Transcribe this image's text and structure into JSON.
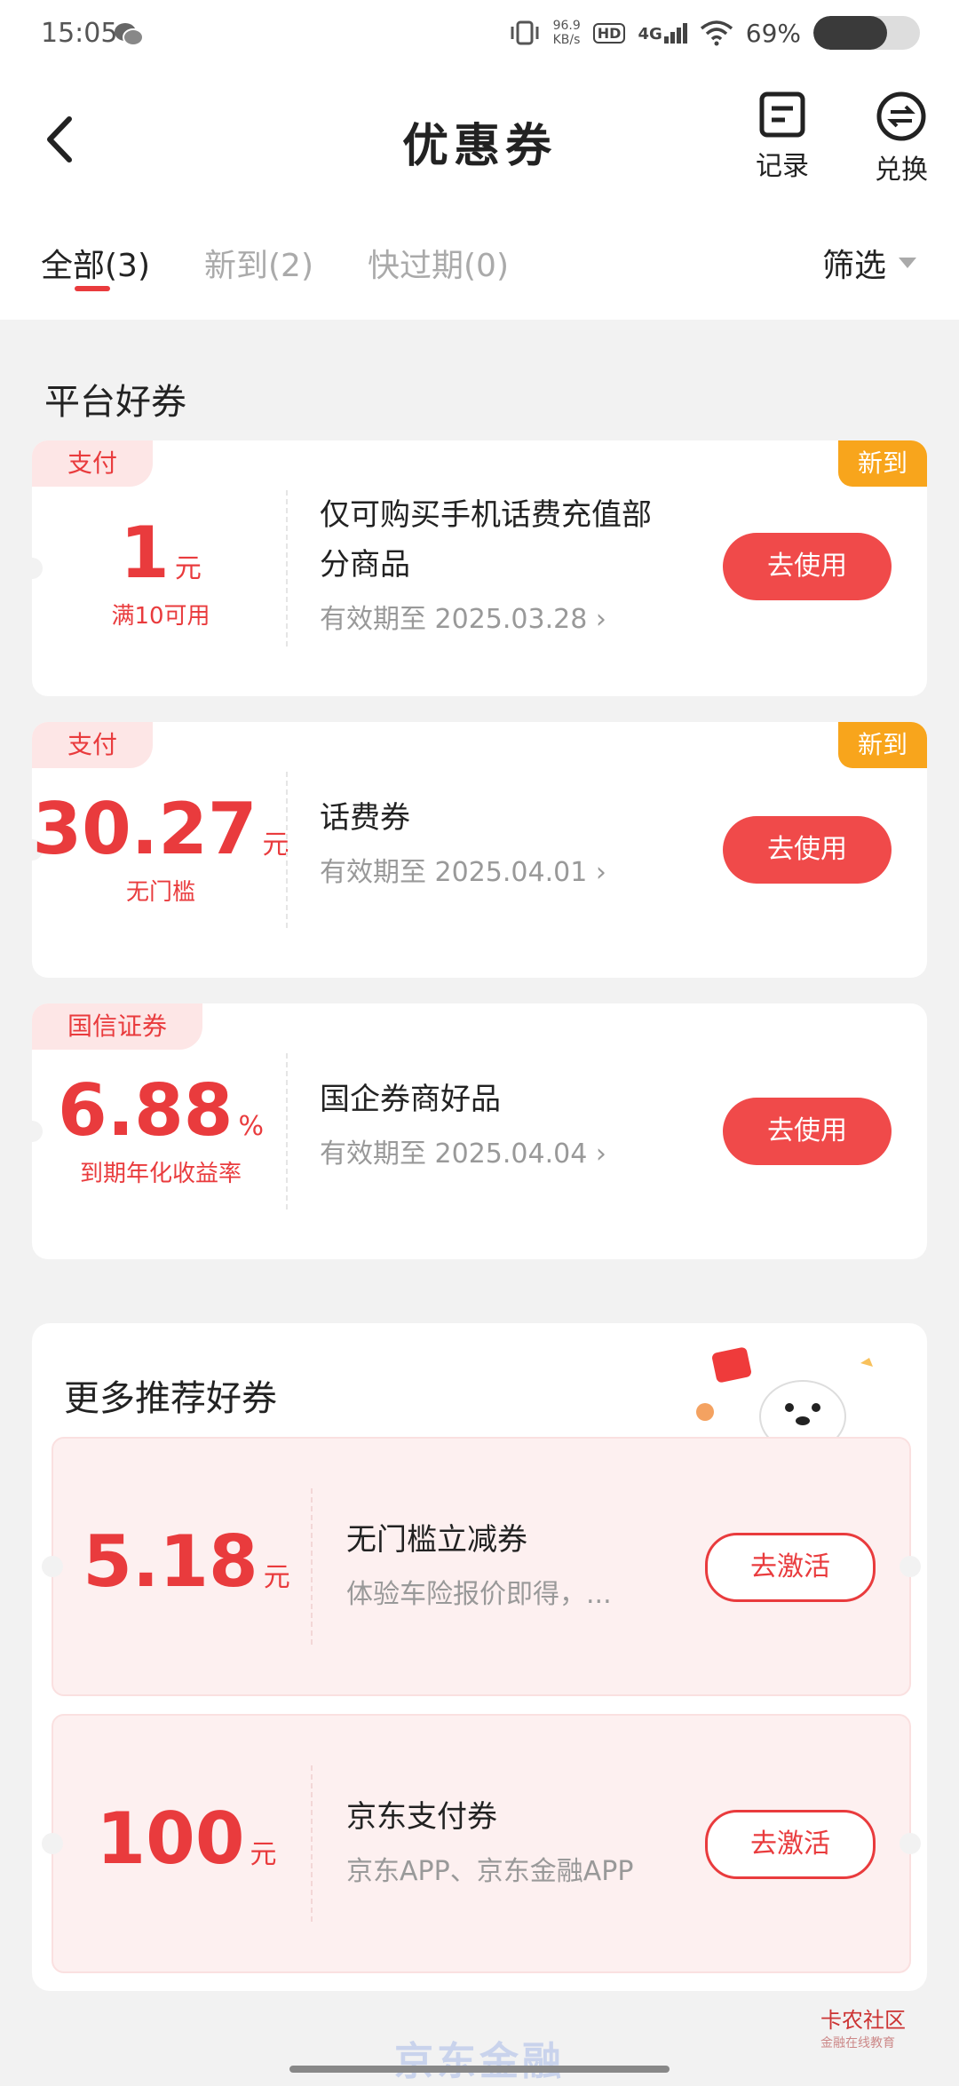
{
  "status_bar": {
    "time": "15:05",
    "net_speed_value": "96.9",
    "net_speed_unit": "KB/s",
    "hd": "HD",
    "network": "4G",
    "battery_text": "69%",
    "battery_level": 0.69
  },
  "header": {
    "title": "优惠券",
    "record_label": "记录",
    "exchange_label": "兑换"
  },
  "tabs": [
    {
      "label": "全部(3)",
      "active": true
    },
    {
      "label": "新到(2)",
      "active": false
    },
    {
      "label": "快过期(0)",
      "active": false
    }
  ],
  "filter_label": "筛选",
  "platform_section_title": "平台好券",
  "coupons": [
    {
      "tag": "支付",
      "new_tag": "新到",
      "amount": "1",
      "unit": "元",
      "condition": "满10可用",
      "desc": "仅可购买手机话费充值部分商品",
      "expiry": "有效期至 2025.03.28",
      "action": "去使用"
    },
    {
      "tag": "支付",
      "new_tag": "新到",
      "amount": "30.27",
      "unit": "元",
      "condition": "无门槛",
      "desc": "话费券",
      "expiry": "有效期至 2025.04.01",
      "action": "去使用"
    },
    {
      "tag": "国信证券",
      "new_tag": "",
      "amount": "6.88",
      "unit": "%",
      "condition": "到期年化收益率",
      "desc": "国企券商好品",
      "expiry": "有效期至 2025.04.04",
      "action": "去使用"
    }
  ],
  "recommend": {
    "title": "更多推荐好券",
    "items": [
      {
        "amount": "5.18",
        "unit": "元",
        "name": "无门槛立减券",
        "desc": "体验车险报价即得，...",
        "action": "去激活"
      },
      {
        "amount": "100",
        "unit": "元",
        "name": "京东支付券",
        "desc": "京东APP、京东金融APP",
        "action": "去激活"
      }
    ]
  },
  "footer": {
    "brand": "京东金融",
    "watermark": "卡农社区",
    "watermark_sub": "金融在线教育"
  },
  "colors": {
    "accent": "#e93b3d",
    "new_tag": "#f8a51c",
    "background": "#f2f2f2"
  }
}
